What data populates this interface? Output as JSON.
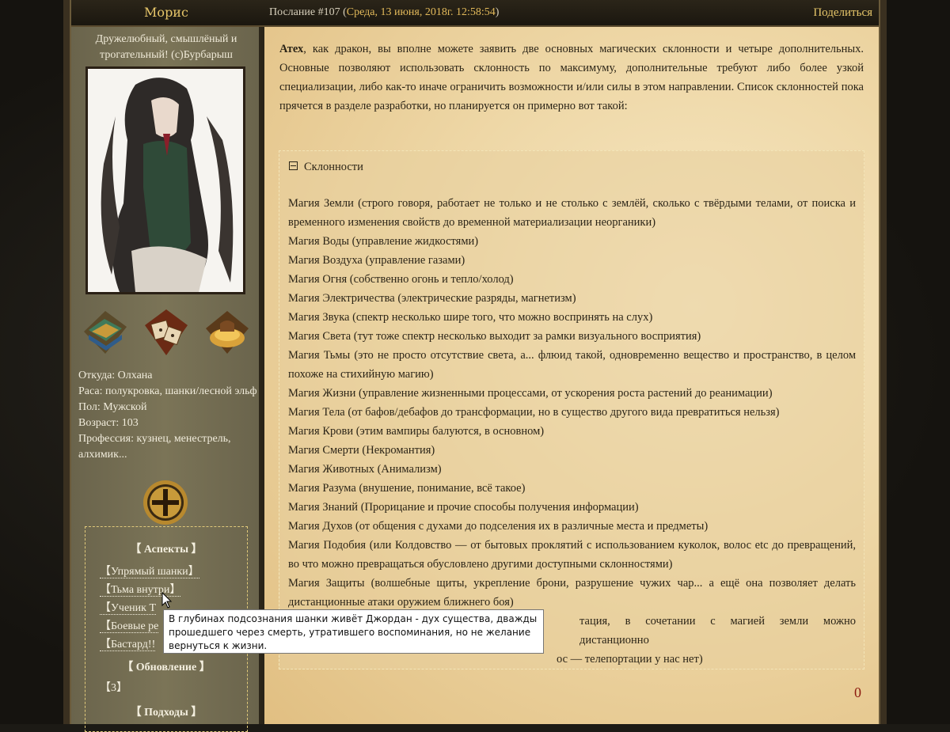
{
  "header": {
    "author": "Морис",
    "post_label": "Послание #107",
    "post_date": "Среда, 13 июня, 2018г. 12:58:54",
    "share": "Поделиться"
  },
  "profile": {
    "tagline": "Дружелюбный, смышлёный и трогательный! (с)Бурбарыш",
    "from": "Откуда: Олхана",
    "race": "Раса: полукровка, шанки/лесной эльф",
    "gender": "Пол: Мужской",
    "age": "Возраст: 103",
    "profession": "Профессия: кузнец, менестрель, алхимик...",
    "awards": [
      "books-icon",
      "dice-icon",
      "treasure-icon"
    ],
    "aspects": {
      "title": "【 Аспекты 】",
      "items": [
        "【Упрямый шанки】",
        "【Тьма внутри】",
        "【Ученик Т",
        "【Боевые ре",
        "【Бастард!!"
      ],
      "update_title": "【 Обновление 】",
      "update_value": "【3】",
      "approaches_title": "【 Подходы 】"
    }
  },
  "post": {
    "intro_bold": "Атех",
    "intro": ", как дракон, вы вполне можете заявить две основных магических склонности и четыре дополнительных. Основные позволяют использовать склонность по максимуму, дополнительные требуют либо более узкой специализации, либо как-то иначе ограничить возможности и/или силы в этом направлении. Список склонностей пока прячется в разделе разработки, но планируется он примерно вот такой:",
    "spoiler_title": "Склонности",
    "lines": [
      "Магия Земли (строго говоря, работает не только и не столько с землёй, сколько с твёрдыми телами, от поиска и временного изменения свойств до временной материализации неорганики)",
      "Магия Воды (управление жидкостями)",
      "Магия Воздуха (управление газами)",
      "Магия Огня (собственно огонь и тепло/холод)",
      "Магия Электричества (электрические разряды, магнетизм)",
      "Магия Звука (спектр несколько шире того, что можно воспринять на слух)",
      "Магия Света (тут тоже спектр несколько выходит за рамки визуального восприятия)",
      "Магия Тьмы (это не просто отсутствие света, а... флюид такой, одновременно вещество и пространство, в целом похоже на стихийную магию)",
      "Магия Жизни (управление жизненными процессами, от ускорения роста растений до реанимации)",
      "Магия Тела (от бафов/дебафов до трансформации, но в существо другого вида превратиться нельзя)",
      "Магия Крови (этим вампиры балуются, в основном)",
      "Магия Смерти (Некромантия)",
      "Магия Животных (Анимализм)",
      "Магия Разума (внушение, понимание, всё такое)",
      "Магия Знаний (Прорицание и прочие способы получения информации)",
      "Магия Духов (от общения с духами до подселения их в различные места и предметы)",
      "Магия Подобия (или Колдовство — от бытовых проклятий с использованием куколок, волос etc до превращений, во что можно превращаться обусловлено другими доступными склонностями)",
      "Магия Защиты (волшебные щиты, укрепление брони, разрушение чужих чар... а ещё она позволяет делать дистанционные атаки оружием ближнего боя)"
    ],
    "line_tail_1": "тация, в сочетании с магией земли можно дистанционно",
    "line_tail_2": "ос — телепортации у нас нет)",
    "count": "0"
  },
  "tooltip": {
    "text": "В глубинах подсознания шанки живёт Джордан - дух существа, дважды прошедшего через смерть, утратившего воспоминания, но не желание вернуться к жизни."
  }
}
